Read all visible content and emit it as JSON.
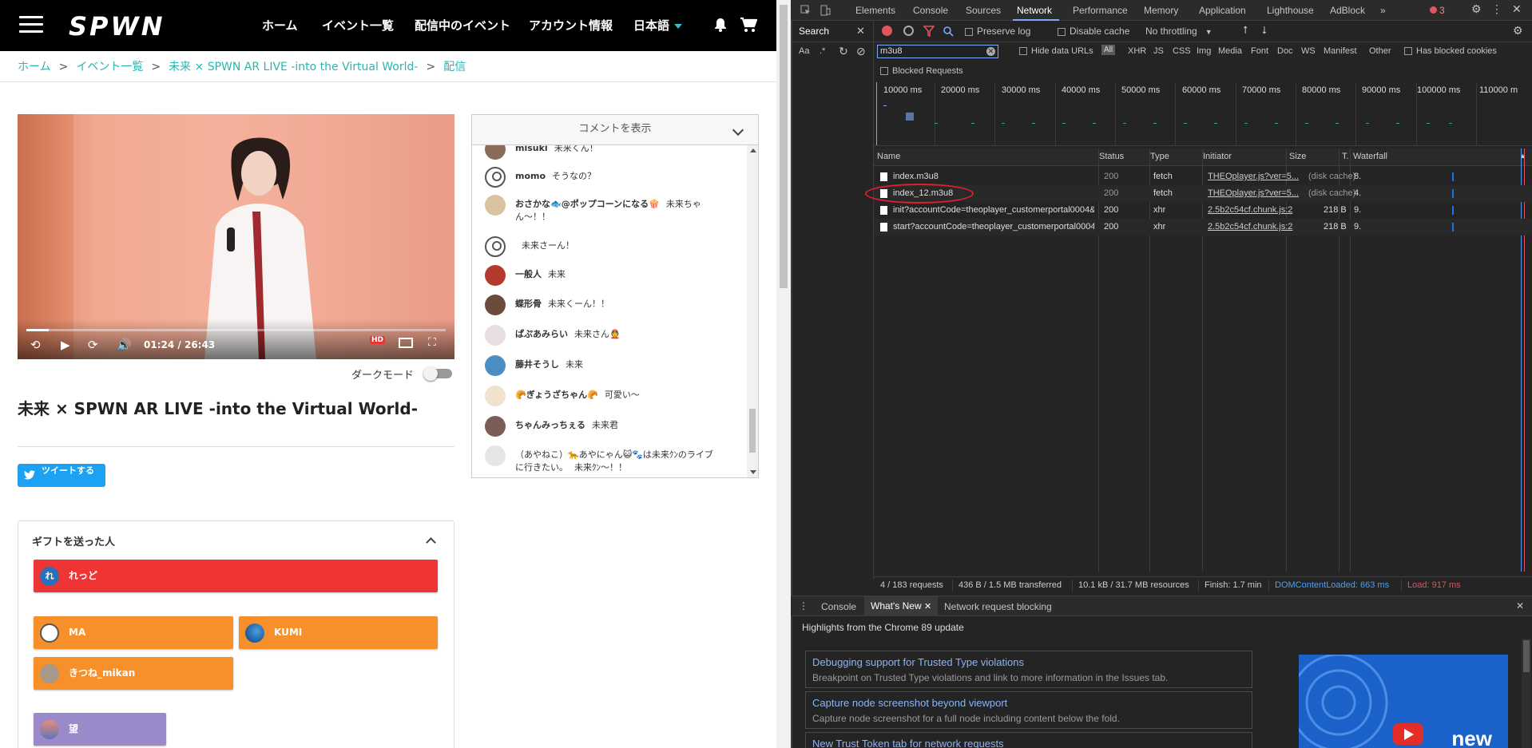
{
  "nav": {
    "logo": "SPWN",
    "links": [
      "ホーム",
      "イベント一覧",
      "配信中のイベント",
      "アカウント情報"
    ],
    "language": "日本語",
    "menu_icon": "hamburger-icon",
    "bell_icon": "bell-icon",
    "cart_icon": "cart-icon"
  },
  "breadcrumb": {
    "items": [
      "ホーム",
      "イベント一覧",
      "未来 × SPWN AR LIVE -into the Virtual World-",
      "配信"
    ],
    "separator": ">"
  },
  "player": {
    "current_time": "01:24",
    "separator": "/",
    "duration": "26:43",
    "hd_badge": "HD",
    "progress_fraction": 0.053
  },
  "dark_mode": {
    "label": "ダークモード",
    "enabled": false
  },
  "event": {
    "title": "未来 × SPWN AR LIVE -into the Virtual World-"
  },
  "tweet_button": {
    "label": "ツイートする"
  },
  "chat": {
    "header": "コメントを表示",
    "comments": [
      {
        "user": "misuki",
        "text": "未来くん！"
      },
      {
        "user": "momo",
        "text": "そうなの？"
      },
      {
        "user": "おさかな🐟@ポップコーンになる🍿",
        "text": "未来ちゃん〜！！"
      },
      {
        "user": "",
        "text": "未来さーん！"
      },
      {
        "user": "一般人",
        "text": "未来"
      },
      {
        "user": "蝶形骨",
        "text": "未来くーん！！"
      },
      {
        "user": "ぱぷあみらい",
        "text": "未来さん👲"
      },
      {
        "user": "藤井そうし",
        "text": "未来"
      },
      {
        "user": "🥐ぎょうざちゃん🥐",
        "text": "可愛い〜"
      },
      {
        "user": "ちゃんみっちぇる",
        "text": "未来君"
      },
      {
        "user": "（あやねこ）🐆あやにゃん😺🐾は未来ｸﾝのライブに行きたい。",
        "text": "未来ｸﾝ〜！！"
      }
    ]
  },
  "gifts": {
    "title": "ギフトを送った人",
    "senders": [
      {
        "name": "れっど",
        "avatar_text": "れ",
        "color": "#ef3436"
      },
      {
        "name": "MA",
        "color": "#f7902b"
      },
      {
        "name": "KUMI",
        "color": "#f7902b"
      },
      {
        "name": "きつね_mikan",
        "color": "#f7902b"
      },
      {
        "name": "望",
        "color": "#9a8ac9"
      }
    ]
  },
  "devtools": {
    "tabs": [
      "Elements",
      "Console",
      "Sources",
      "Network",
      "Performance",
      "Memory",
      "Application",
      "Lighthouse",
      "AdBlock"
    ],
    "active_tab": "Network",
    "error_count": "3",
    "search_label": "Search",
    "preserve_log": "Preserve log",
    "disable_cache": "Disable cache",
    "throttling": "No throttling",
    "search_options": [
      "Aa",
      ".*"
    ],
    "filter_value": "m3u8",
    "hide_data_urls": "Hide data URLs",
    "all_label": "All",
    "type_filters": [
      "XHR",
      "JS",
      "CSS",
      "Img",
      "Media",
      "Font",
      "Doc",
      "WS",
      "Manifest",
      "Other"
    ],
    "has_blocked_cookies": "Has blocked cookies",
    "blocked_requests": "Blocked Requests",
    "timeline_ticks": [
      "10000 ms",
      "20000 ms",
      "30000 ms",
      "40000 ms",
      "50000 ms",
      "60000 ms",
      "70000 ms",
      "80000 ms",
      "90000 ms",
      "100000 ms",
      "110000 m"
    ],
    "columns": [
      "Name",
      "Status",
      "Type",
      "Initiator",
      "Size",
      "T.",
      "Waterfall"
    ],
    "requests": [
      {
        "name": "index.m3u8",
        "status": "200",
        "type": "fetch",
        "initiator": "THEOplayer.js?ver=5...",
        "size": "(disk cache)",
        "time": "8."
      },
      {
        "name": "index_12.m3u8",
        "status": "200",
        "type": "fetch",
        "initiator": "THEOplayer.js?ver=5...",
        "size": "(disk cache)",
        "time": "4."
      },
      {
        "name": "init?accountCode=theoplayer_customerportal0004&use...",
        "status": "200",
        "type": "xhr",
        "initiator": "2.5b2c54cf.chunk.js:2",
        "size": "218 B",
        "time": "9."
      },
      {
        "name": "start?accountCode=theoplayer_customerportal0004&us...",
        "status": "200",
        "type": "xhr",
        "initiator": "2.5b2c54cf.chunk.js:2",
        "size": "218 B",
        "time": "9."
      }
    ],
    "summary": {
      "requests": "4 / 183 requests",
      "transferred": "436 B / 1.5 MB transferred",
      "resources": "10.1 kB / 31.7 MB resources",
      "finish": "Finish: 1.7 min",
      "dom_loaded": "DOMContentLoaded: 663 ms",
      "load": "Load: 917 ms"
    },
    "drawer_tabs": [
      "Console",
      "What's New",
      "Network request blocking"
    ],
    "whats_new": {
      "heading": "Highlights from the Chrome 89 update",
      "items": [
        {
          "title": "Debugging support for Trusted Type violations",
          "desc": "Breakpoint on Trusted Type violations and link to more information in the Issues tab."
        },
        {
          "title": "Capture node screenshot beyond viewport",
          "desc": "Capture node screenshot for a full node including content below the fold."
        },
        {
          "title": "New Trust Token tab for network requests",
          "desc": ""
        }
      ],
      "promo_label": "new"
    },
    "colors": {
      "accent": "#7cacf8",
      "error": "#f28b82",
      "dom": "#4e9ff4",
      "load": "#e0555f"
    }
  }
}
